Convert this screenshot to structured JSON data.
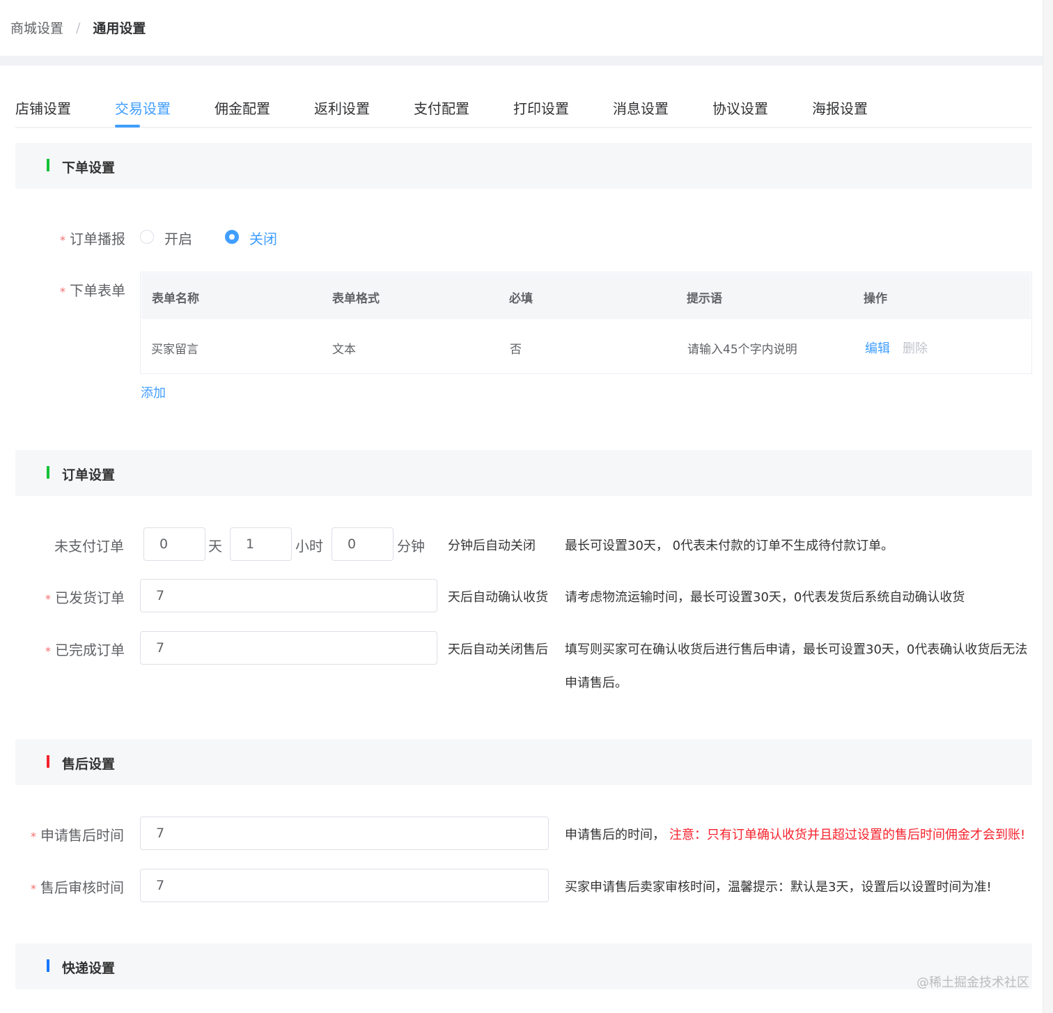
{
  "breadcrumb": {
    "parent": "商城设置",
    "separator": "/",
    "current": "通用设置"
  },
  "tabs": [
    {
      "label": "店铺设置",
      "active": false
    },
    {
      "label": "交易设置",
      "active": true
    },
    {
      "label": "佣金配置",
      "active": false
    },
    {
      "label": "返利设置",
      "active": false
    },
    {
      "label": "支付配置",
      "active": false
    },
    {
      "label": "打印设置",
      "active": false
    },
    {
      "label": "消息设置",
      "active": false
    },
    {
      "label": "协议设置",
      "active": false
    },
    {
      "label": "海报设置",
      "active": false
    }
  ],
  "colors": {
    "accent": "#409eff",
    "required": "#f56c6c",
    "warning": "#f5222d",
    "bar_green": "#13c236",
    "bar_red": "#f5222d",
    "bar_blue": "#1677ff"
  },
  "order_section": {
    "title": "下单设置",
    "broadcast": {
      "label": "订单播报",
      "options": [
        "开启",
        "关闭"
      ],
      "selected": "关闭"
    },
    "form": {
      "label": "下单表单",
      "columns": [
        "表单名称",
        "表单格式",
        "必填",
        "提示语",
        "操作"
      ],
      "rows": [
        {
          "name": "买家留言",
          "format": "文本",
          "required": "否",
          "hint": "请输入45个字内说明",
          "edit": "编辑",
          "delete": "删除"
        }
      ],
      "add_label": "添加"
    }
  },
  "orders_section": {
    "title": "订单设置",
    "unpaid": {
      "label": "未支付订单",
      "days": "0",
      "day_unit": "天",
      "hours": "1",
      "hour_unit": "小时",
      "minutes": "0",
      "minute_unit": "分钟",
      "suffix": "分钟后自动关闭",
      "tip": "最长可设置30天， 0代表未付款的订单不生成待付款订单。"
    },
    "shipped": {
      "label": "已发货订单",
      "value": "7",
      "suffix": "天后自动确认收货",
      "tip": "请考虑物流运输时间，最长可设置30天，0代表发货后系统自动确认收货"
    },
    "completed": {
      "label": "已完成订单",
      "value": "7",
      "suffix": "天后自动关闭售后",
      "tip_line1": "填写则买家可在确认收货后进行售后申请，最长可设置30天，0代表确认收货后无法",
      "tip_line2": "申请售后。"
    }
  },
  "aftersale_section": {
    "title": "售后设置",
    "apply_time": {
      "label": "申请售后时间",
      "value": "7",
      "tip": "申请售后的时间，",
      "warning": "注意：只有订单确认收货并且超过设置的售后时间佣金才会到账!"
    },
    "review_time": {
      "label": "售后审核时间",
      "value": "7",
      "tip": "买家申请售后卖家审核时间，温馨提示：默认是3天，设置后以设置时间为准!"
    }
  },
  "express_section": {
    "title": "快递设置"
  },
  "watermark": "@稀土掘金技术社区"
}
